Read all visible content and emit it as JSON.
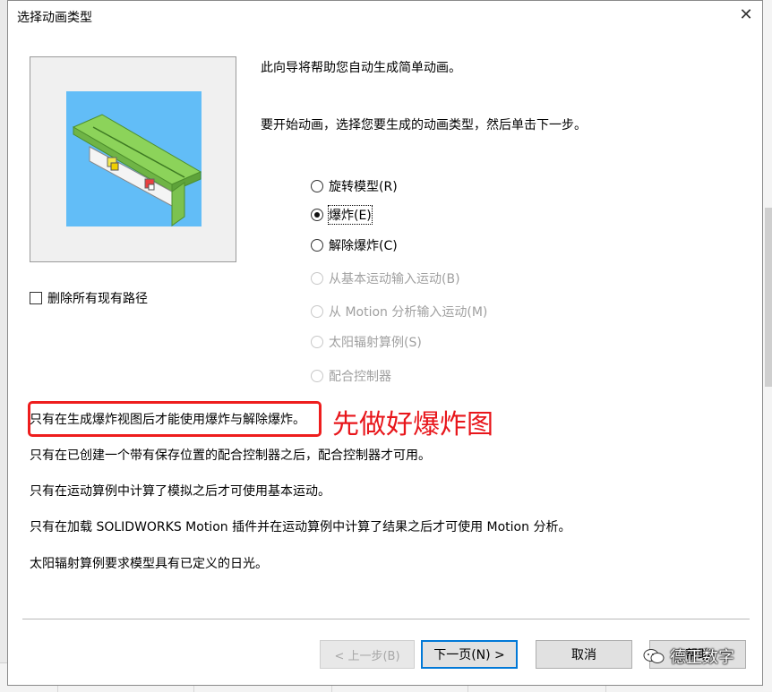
{
  "dialog": {
    "title": "选择动画类型",
    "close_label": "✕"
  },
  "intro": {
    "line1": "此向导将帮助您自动生成简单动画。",
    "line2": "要开始动画，选择您要生成的动画类型，然后单击下一步。"
  },
  "options": [
    {
      "label": "旋转模型(R)",
      "checked": false,
      "disabled": false
    },
    {
      "label": "爆炸(E)",
      "checked": true,
      "disabled": false
    },
    {
      "label": "解除爆炸(C)",
      "checked": false,
      "disabled": false
    },
    {
      "label": "从基本运动输入运动(B)",
      "checked": false,
      "disabled": true
    },
    {
      "label": "从 Motion 分析输入运动(M)",
      "checked": false,
      "disabled": true
    },
    {
      "label": "太阳辐射算例(S)",
      "checked": false,
      "disabled": true
    },
    {
      "label": "配合控制器",
      "checked": false,
      "disabled": true
    }
  ],
  "checkbox": {
    "label": "删除所有现有路径",
    "checked": false
  },
  "notes": [
    "只有在生成爆炸视图后才能使用爆炸与解除爆炸。",
    "只有在已创建一个带有保存位置的配合控制器之后，配合控制器才可用。",
    "只有在运动算例中计算了模拟之后才可使用基本运动。",
    "只有在加载 SOLIDWORKS Motion 插件并在运动算例中计算了结果之后才可使用 Motion 分析。",
    "太阳辐射算例要求模型具有已定义的日光。"
  ],
  "annotation": "先做好爆炸图",
  "buttons": {
    "back": "< 上一步(B)",
    "next": "下一页(N) >",
    "cancel": "取消",
    "help": "帮助"
  },
  "watermark": "德正数字",
  "colors": {
    "highlight": "#ee1d1d",
    "preview_bg": "#62bdf7",
    "model_green": "#8cd35a"
  }
}
